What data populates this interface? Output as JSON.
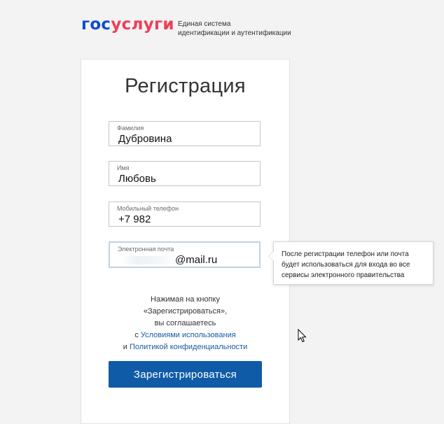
{
  "header": {
    "logo_gos": "гос",
    "logo_uslugi": "услуги",
    "tagline_line1": "Единая система",
    "tagline_line2": "идентификации и аутентификации"
  },
  "form": {
    "title": "Регистрация",
    "fields": [
      {
        "label": "Фамилия",
        "value": "Дубровина"
      },
      {
        "label": "Имя",
        "value": "Любовь"
      },
      {
        "label": "Мобильный телефон",
        "value": "+7 982"
      },
      {
        "label": "Электронная почта",
        "value": "@mail.ru"
      }
    ],
    "tooltip": {
      "line1": "После регистрации телефон или почта",
      "line2": "будет использоваться для входа во все",
      "line3": "сервисы электронного правительства"
    },
    "agreement": {
      "line1": "Нажимая на кнопку",
      "line2": "«Зарегистрироваться»,",
      "line3": "вы соглашаетесь",
      "line4_prefix": "с ",
      "terms_link": "Условиями использования",
      "line5_prefix": "и ",
      "privacy_link": "Политикой конфиденциальности"
    },
    "submit_label": "Зарегистрироваться"
  },
  "colors": {
    "brand_blue": "#0d4cd3",
    "brand_red": "#ee3f58",
    "button": "#0f5ba8",
    "link": "#1a5aa0"
  },
  "icons": [
    "mouse-cursor-icon"
  ]
}
